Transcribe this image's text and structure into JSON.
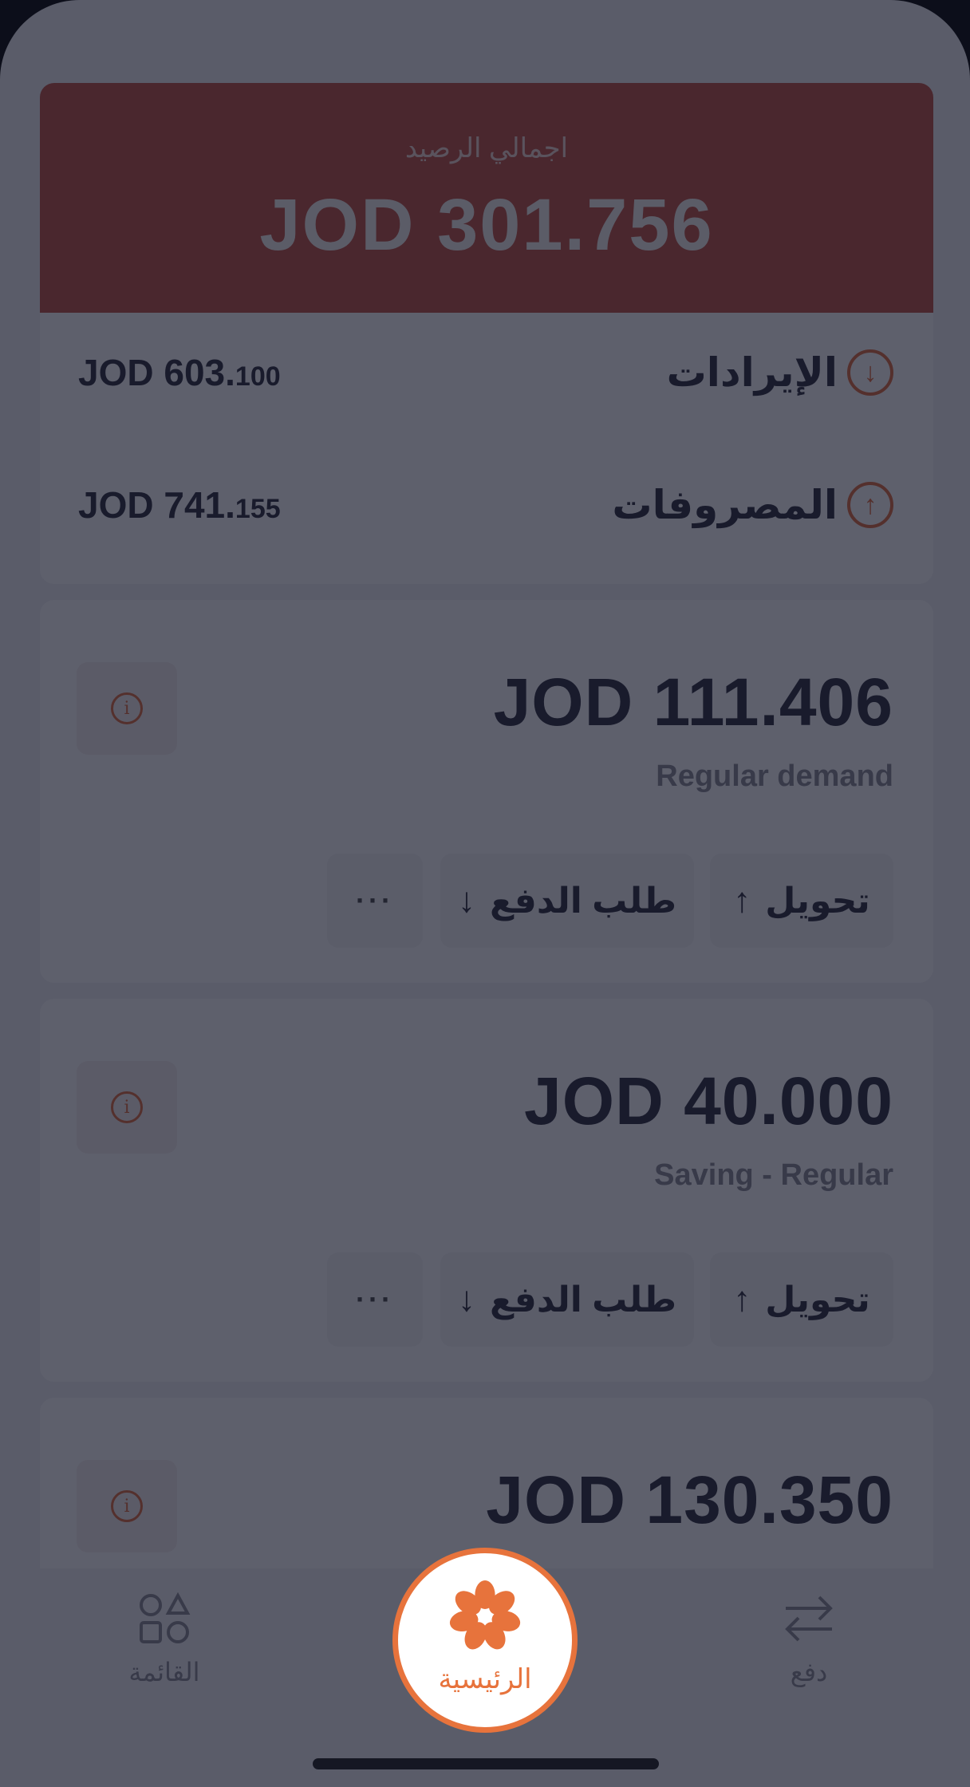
{
  "balance": {
    "label": "اجمالي الرصيد",
    "value": "JOD 301.756"
  },
  "summary": {
    "income": {
      "label": "الإيرادات",
      "amount_main": "JOD 603.",
      "amount_fraction": "100"
    },
    "expenses": {
      "label": "المصروفات",
      "amount_main": "JOD 741.",
      "amount_fraction": "155"
    }
  },
  "accounts": [
    {
      "amount": "JOD 111.406",
      "type": "Regular demand",
      "transfer_label": "تحويل",
      "request_label": "طلب الدفع",
      "more_label": "···"
    },
    {
      "amount": "JOD 40.000",
      "type": "Saving - Regular",
      "transfer_label": "تحويل",
      "request_label": "طلب الدفع",
      "more_label": "···"
    },
    {
      "amount": "JOD 130.350",
      "type": "",
      "transfer_label": "",
      "request_label": "",
      "more_label": ""
    }
  ],
  "nav": {
    "menu_label": "القائمة",
    "home_label": "الرئيسية",
    "pay_label": "دفع"
  },
  "colors": {
    "accent": "#e7733c",
    "balance_card": "#c14f3e",
    "overlay": "rgba(18,20,38,0.68)"
  }
}
